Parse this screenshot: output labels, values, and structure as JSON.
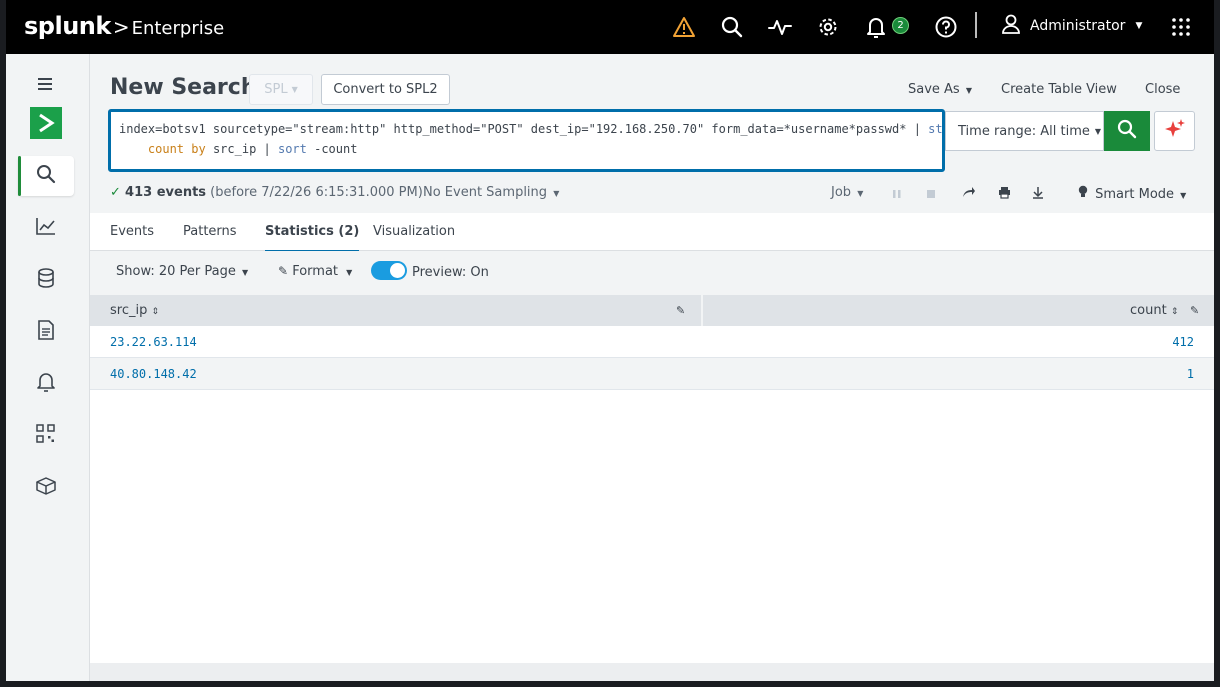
{
  "header": {
    "brand": "splunk",
    "separator": ">",
    "product": "Enterprise",
    "notifications_count": "2",
    "user_name": "Administrator",
    "icons": [
      "warning-icon",
      "search-icon",
      "activity-icon",
      "gear-icon",
      "bell-icon",
      "help-icon",
      "user-icon",
      "apps-grid-icon"
    ]
  },
  "sidebar": {
    "items": [
      "menu",
      "app-logo",
      "search",
      "dashboards",
      "datasets",
      "reports",
      "alerts",
      "apps",
      "packages"
    ]
  },
  "page": {
    "title": "New Search",
    "spl_label": "SPL",
    "convert_label": "Convert to SPL2",
    "save_as": "Save As",
    "create_table_view": "Create Table View",
    "close": "Close"
  },
  "search": {
    "line1_plain": "index=botsv1 sourcetype=\"stream:http\" http_method=\"POST\" dest_ip=\"192.168.250.70\" form_data=*username*passwd* | ",
    "line1_cmd": "stats",
    "line2_fn": "count",
    "line2_by": "by",
    "line2_field": " src_ip | ",
    "line2_cmd": "sort",
    "line2_rest": " -count",
    "time_range": "Time range: All time"
  },
  "status": {
    "events_count": "413 events",
    "events_detail": "(before 7/22/26 6:15:31.000 PM)",
    "sampling": "No Event Sampling",
    "job": "Job",
    "mode": "Smart Mode"
  },
  "tabs": [
    "Events",
    "Patterns",
    "Statistics (2)",
    "Visualization"
  ],
  "options": {
    "per_page": "Show: 20 Per Page",
    "format": "Format",
    "preview": "Preview: On"
  },
  "table": {
    "columns": [
      "src_ip",
      "count"
    ],
    "rows": [
      {
        "src_ip": "23.22.63.114",
        "count": "412"
      },
      {
        "src_ip": "40.80.148.42",
        "count": "1"
      }
    ]
  },
  "colors": {
    "accent": "#006eaa",
    "brand_green": "#1a8a3a",
    "warning": "#f1a235"
  }
}
